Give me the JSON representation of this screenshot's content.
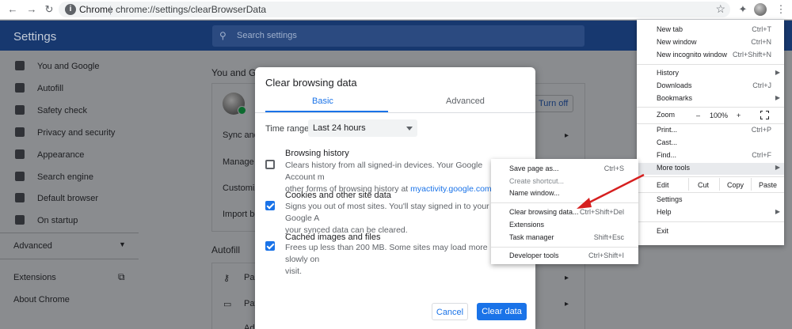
{
  "browser": {
    "site_label": "Chrome",
    "url": "chrome://settings/clearBrowserData"
  },
  "settings": {
    "title": "Settings",
    "search_placeholder": "Search settings",
    "sidebar": [
      {
        "label": "You and Google",
        "icon": "person-icon"
      },
      {
        "label": "Autofill",
        "icon": "autofill-icon"
      },
      {
        "label": "Safety check",
        "icon": "shield-check-icon"
      },
      {
        "label": "Privacy and security",
        "icon": "shield-icon"
      },
      {
        "label": "Appearance",
        "icon": "palette-icon"
      },
      {
        "label": "Search engine",
        "icon": "search-icon"
      },
      {
        "label": "Default browser",
        "icon": "browser-icon"
      },
      {
        "label": "On startup",
        "icon": "power-icon"
      }
    ],
    "advanced_label": "Advanced",
    "extensions_label": "Extensions",
    "about_label": "About Chrome",
    "section_you_and_google": "You and Goo",
    "turn_off_label": "Turn off",
    "rows": [
      "Sync and G",
      "Manage yo",
      "Customize",
      "Import bo"
    ],
    "section_autofill": "Autofill",
    "autofill_rows": [
      "Pa",
      "Pay",
      "Ad"
    ]
  },
  "dialog": {
    "title": "Clear browsing data",
    "tabs": {
      "basic": "Basic",
      "advanced": "Advanced"
    },
    "time_range_label": "Time range",
    "time_range_value": "Last 24 hours",
    "options": [
      {
        "title": "Browsing history",
        "desc": "Clears history from all signed-in devices. Your Google Account m",
        "desc2": "other forms of browsing history at ",
        "link": "myactivity.google.com",
        "desc2_end": ".",
        "checked": false
      },
      {
        "title": "Cookies and other site data",
        "desc": "Signs you out of most sites. You'll stay signed in to your Google A",
        "desc2": "your synced data can be cleared.",
        "checked": true
      },
      {
        "title": "Cached images and files",
        "desc": "Frees up less than 200 MB. Some sites may load more slowly on",
        "desc2": "visit.",
        "checked": true
      }
    ],
    "cancel_label": "Cancel",
    "clear_label": "Clear data"
  },
  "menu": {
    "new_tab": {
      "label": "New tab",
      "shortcut": "Ctrl+T"
    },
    "new_window": {
      "label": "New window",
      "shortcut": "Ctrl+N"
    },
    "new_incognito": {
      "label": "New incognito window",
      "shortcut": "Ctrl+Shift+N"
    },
    "history": {
      "label": "History"
    },
    "downloads": {
      "label": "Downloads",
      "shortcut": "Ctrl+J"
    },
    "bookmarks": {
      "label": "Bookmarks"
    },
    "zoom": {
      "label": "Zoom",
      "minus": "–",
      "value": "100%",
      "plus": "+"
    },
    "print": {
      "label": "Print...",
      "shortcut": "Ctrl+P"
    },
    "cast": {
      "label": "Cast..."
    },
    "find": {
      "label": "Find...",
      "shortcut": "Ctrl+F"
    },
    "more_tools": {
      "label": "More tools"
    },
    "edit": {
      "label": "Edit",
      "cut": "Cut",
      "copy": "Copy",
      "paste": "Paste"
    },
    "settings": {
      "label": "Settings"
    },
    "help": {
      "label": "Help"
    },
    "exit": {
      "label": "Exit"
    }
  },
  "submenu": {
    "save_page": {
      "label": "Save page as...",
      "shortcut": "Ctrl+S"
    },
    "create_shortcut": {
      "label": "Create shortcut..."
    },
    "name_window": {
      "label": "Name window..."
    },
    "clear_data": {
      "label": "Clear browsing data...",
      "shortcut": "Ctrl+Shift+Del"
    },
    "extensions": {
      "label": "Extensions"
    },
    "task_manager": {
      "label": "Task manager",
      "shortcut": "Shift+Esc"
    },
    "dev_tools": {
      "label": "Developer tools",
      "shortcut": "Ctrl+Shift+I"
    }
  },
  "colors": {
    "accent": "#1a73e8",
    "annotation_arrow": "#d61f1f",
    "settings_header": "#17386f"
  }
}
